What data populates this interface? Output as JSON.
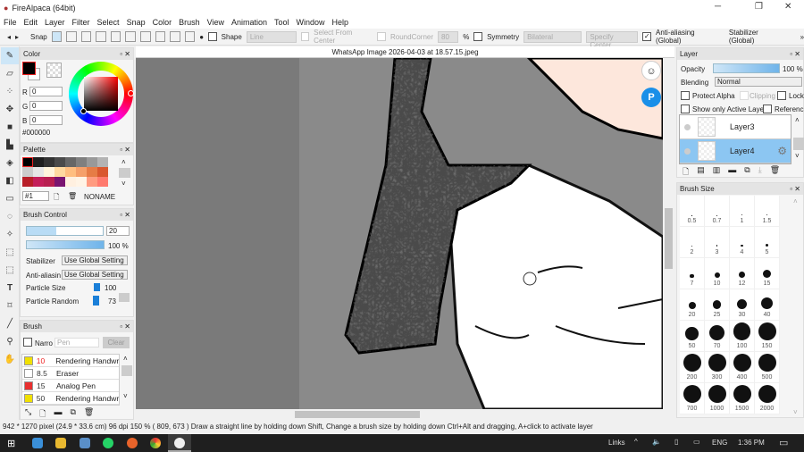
{
  "window": {
    "title": "FireAlpaca (64bit)"
  },
  "menu": [
    "File",
    "Edit",
    "Layer",
    "Filter",
    "Select",
    "Snap",
    "Color",
    "Brush",
    "View",
    "Animation",
    "Tool",
    "Window",
    "Help"
  ],
  "toolbar": {
    "snap": "Snap",
    "shape_label": "Shape",
    "shape_value": "Line",
    "select_from_center": "Select From Center",
    "round_corner": "RoundCorner",
    "round_value": "80",
    "percent": "%",
    "symmetry": "Symmetry",
    "symmetry_value": "Bilateral",
    "specify_center": "Specify Center",
    "antialias": "Anti-aliasing (Global)",
    "stabilizer": "Stabilizer (Global)",
    "more": "»"
  },
  "color_panel": {
    "title": "Color",
    "r_label": "R",
    "r": "0",
    "g_label": "G",
    "g": "0",
    "b_label": "B",
    "b": "0",
    "hex": "#000000"
  },
  "palette": {
    "title": "Palette",
    "colors": [
      "#000000",
      "#1e1e1e",
      "#333333",
      "#4a4a4a",
      "#666666",
      "#7f7f7f",
      "#999999",
      "#b3b3b3",
      "#cccccc",
      "#e6e6e6",
      "#fff4dc",
      "#ffd9a0",
      "#ffbe80",
      "#f5a06a",
      "#e67c46",
      "#d9582f",
      "#b81e28",
      "#c41e5a",
      "#b81e50",
      "#7a1470",
      "#fff0e0",
      "#fff4e6",
      "#ff9b80",
      "#ff7a6e"
    ],
    "number": "#1",
    "name": "NONAME"
  },
  "brush_control": {
    "title": "Brush Control",
    "size": "20",
    "opacity": "100 %",
    "opacity_value": 100,
    "stabilizer_label": "Stabilizer",
    "stabilizer_value": "Use Global Setting",
    "antialias_label": "Anti-aliasin",
    "antialias_value": "Use Global Setting",
    "particle_size_label": "Particle Size",
    "particle_size": "100",
    "particle_random_label": "Particle Random",
    "particle_random": "73"
  },
  "brush": {
    "title": "Brush",
    "narrow_label": "Narro",
    "search_placeholder": "Pen",
    "clear": "Clear",
    "items": [
      {
        "size": "10",
        "name": "Rendering Handwri",
        "color": "#f0e000"
      },
      {
        "size": "8.5",
        "name": "Eraser",
        "color": "#ffffff"
      },
      {
        "size": "15",
        "name": "Analog Pen",
        "color": "#e83030"
      },
      {
        "size": "50",
        "name": "Rendering Handwri",
        "color": "#f0e000"
      }
    ]
  },
  "canvas": {
    "tab": "WhatsApp Image 2026-04-03 at 18.57.15.jpeg"
  },
  "layer_panel": {
    "title": "Layer",
    "opacity_label": "Opacity",
    "opacity": "100 %",
    "opacity_value": 100,
    "blending_label": "Blending",
    "blending": "Normal",
    "protect_alpha": "Protect Alpha",
    "clipping": "Clipping",
    "lock": "Lock",
    "show_active": "Show only Active Laye",
    "reference": "Referenc",
    "layers": [
      {
        "name": "Layer3",
        "active": false
      },
      {
        "name": "Layer4",
        "active": true
      }
    ]
  },
  "brush_size": {
    "title": "Brush Size",
    "sizes": [
      "0.5",
      "0.7",
      "1",
      "1.5",
      "2",
      "3",
      "4",
      "5",
      "7",
      "10",
      "12",
      "15",
      "20",
      "25",
      "30",
      "40",
      "50",
      "70",
      "100",
      "150",
      "200",
      "300",
      "400",
      "500",
      "700",
      "1000",
      "1500",
      "2000"
    ]
  },
  "status": "942 * 1270 pixel   (24.9 * 33.6 cm)   96 dpi   150 %   ( 809, 673 )   Draw a straight line by holding down Shift, Change a brush size by holding down Ctrl+Alt and dragging, A+click to activate layer",
  "taskbar": {
    "links": "Links",
    "lang": "ENG",
    "time": "1:36 PM"
  }
}
